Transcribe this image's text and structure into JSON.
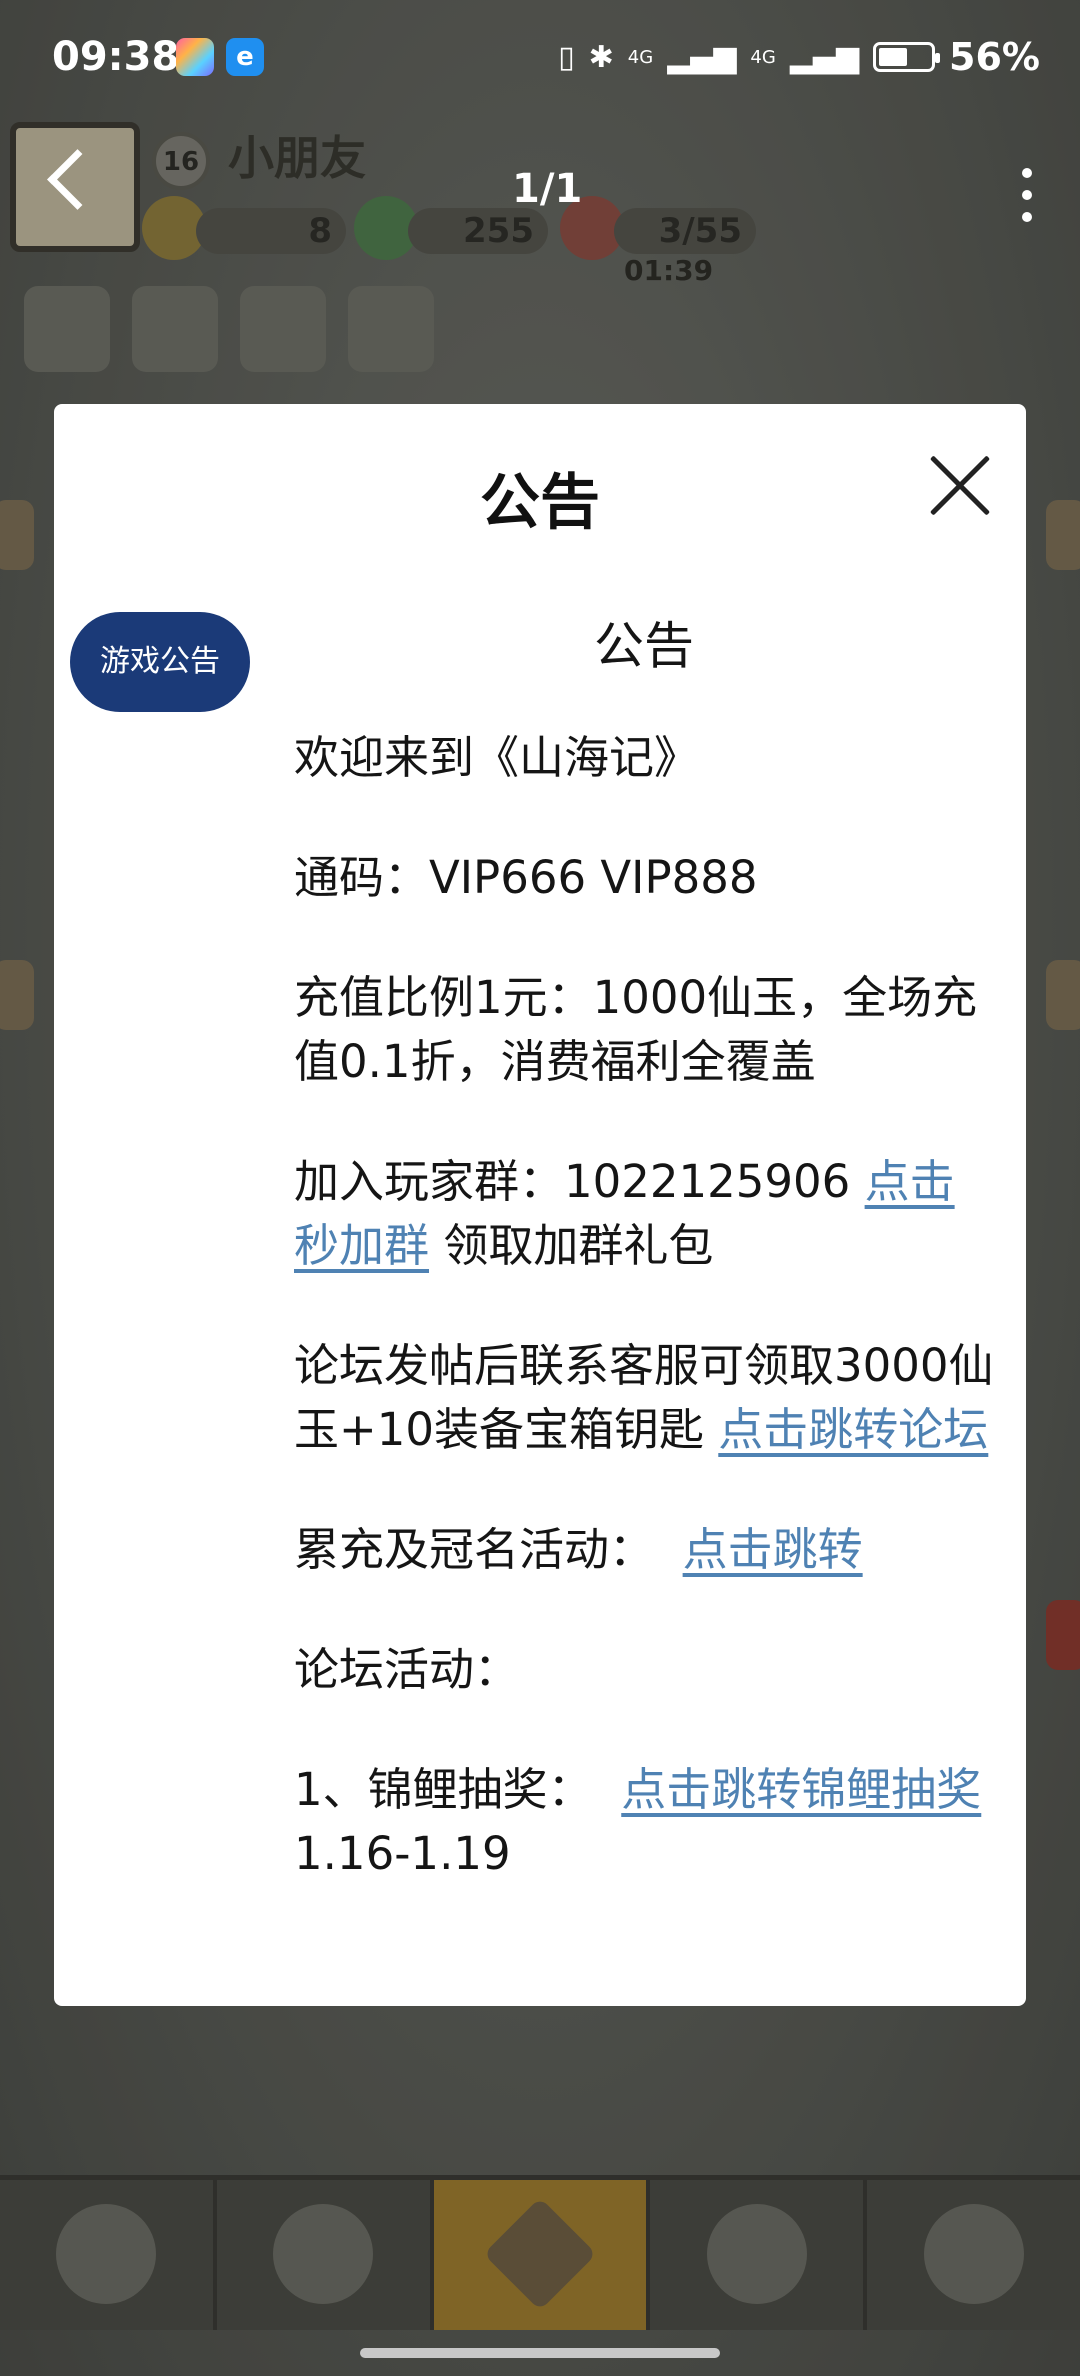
{
  "status_bar": {
    "time": "09:38",
    "app2_icon_text": "e",
    "network1": "4G",
    "network2": "4G",
    "battery_percent": "56%",
    "battery_level": 0.56
  },
  "game": {
    "level": "16",
    "player_name": "小朋友",
    "pager": "1/1",
    "resource1": "8",
    "resource2": "255",
    "resource3": "3/55",
    "timer": "01:39"
  },
  "dialog": {
    "title": "公告",
    "tab_label": "游戏公告",
    "heading": "公告",
    "line_welcome": "欢迎来到《山海记》",
    "line_code": "通码：VIP666 VIP888",
    "line_recharge": "充值比例1元：1000仙玉，全场充值0.1折，消费福利全覆盖",
    "group_prefix": "加入玩家群：1022125906 ",
    "group_link": "点击秒加群",
    "group_suffix": " 领取加群礼包",
    "forum_prefix": "论坛发帖后联系客服可领取3000仙玉+10装备宝箱钥匙 ",
    "forum_link": "点击跳转论坛",
    "activity_prefix": "累充及冠名活动：",
    "activity_link": "点击跳转",
    "forum_activity": "论坛活动：",
    "lottery_prefix": "1、锦鲤抽奖：",
    "lottery_link": "点击跳转锦鲤抽奖",
    "lottery_suffix": " 1.16-1.19"
  },
  "colors": {
    "tab_pill": "#1b3a78",
    "link": "#4f82b3"
  }
}
